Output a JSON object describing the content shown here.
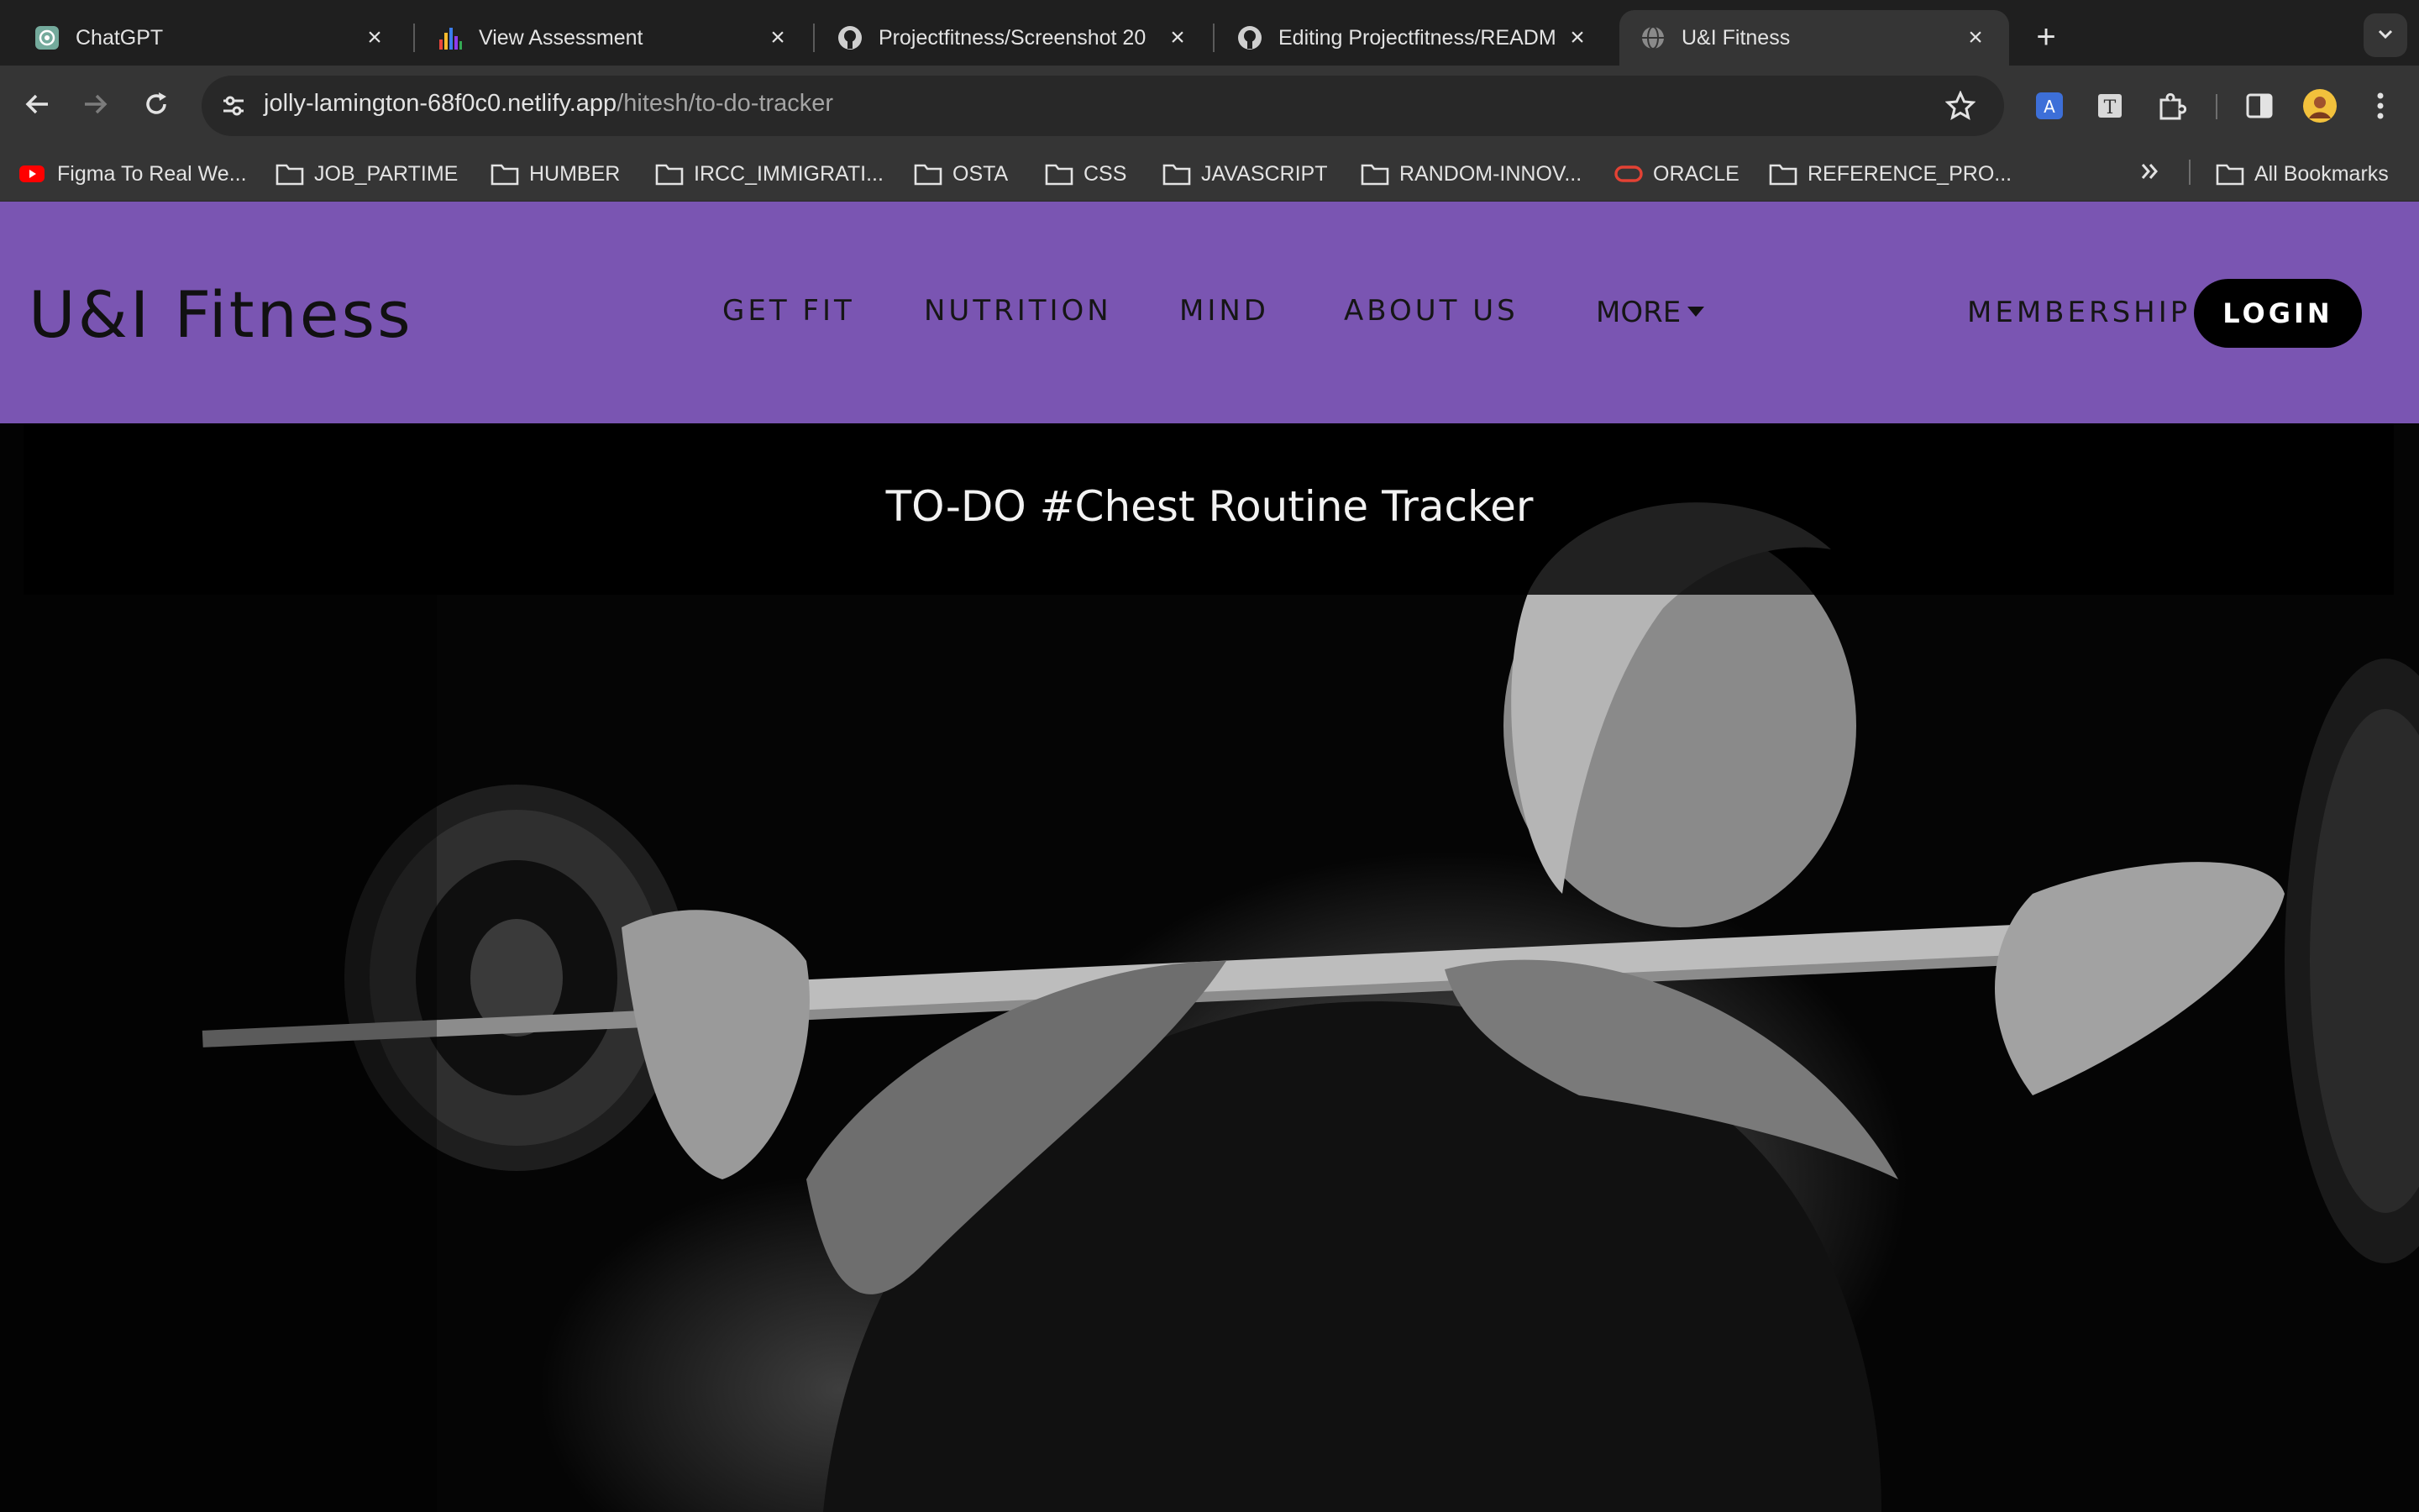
{
  "tabs": [
    {
      "title": "ChatGPT",
      "icon": "chatgpt-icon"
    },
    {
      "title": "View Assessment",
      "icon": "bar-chart-icon"
    },
    {
      "title": "Projectfitness/Screenshot 20",
      "icon": "github-icon"
    },
    {
      "title": "Editing Projectfitness/READM",
      "icon": "github-icon"
    },
    {
      "title": "U&I Fitness",
      "icon": "globe-icon",
      "active": true
    }
  ],
  "address_bar": {
    "domain": "jolly-lamington-68f0c0.netlify.app",
    "path": "/hitesh/to-do-tracker"
  },
  "bookmarks": [
    {
      "label": "Figma To Real We...",
      "icon": "youtube-icon"
    },
    {
      "label": "JOB_PARTIME",
      "icon": "folder-icon"
    },
    {
      "label": "HUMBER",
      "icon": "folder-icon"
    },
    {
      "label": "IRCC_IMMIGRATI...",
      "icon": "folder-icon"
    },
    {
      "label": "OSTA",
      "icon": "folder-icon"
    },
    {
      "label": "CSS",
      "icon": "folder-icon"
    },
    {
      "label": "JAVASCRIPT",
      "icon": "folder-icon"
    },
    {
      "label": "RANDOM-INNOV...",
      "icon": "folder-icon"
    },
    {
      "label": "ORACLE",
      "icon": "oracle-icon"
    },
    {
      "label": "REFERENCE_PRO...",
      "icon": "folder-icon"
    }
  ],
  "all_bookmarks_label": "All Bookmarks",
  "site": {
    "logo": "U&I Fitness",
    "nav": [
      "GET FIT",
      "NUTRITION",
      "MIND",
      "ABOUT US",
      "MORE"
    ],
    "membership": "MEMBERSHIP",
    "login": "LOGIN",
    "header_color": "#7a55b2"
  },
  "hero": {
    "title": "TO-DO #Chest Routine Tracker"
  }
}
